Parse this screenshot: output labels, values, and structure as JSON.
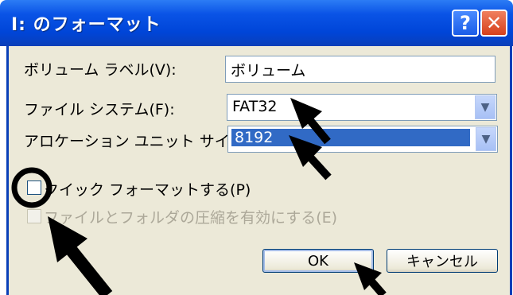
{
  "dialog": {
    "title": "I: のフォーマット",
    "help_glyph": "?",
    "close_glyph": "✕",
    "volume_label": {
      "label": "ボリューム ラベル(V):",
      "value": "ボリューム"
    },
    "file_system": {
      "label": "ファイル システム(F):",
      "value": "FAT32"
    },
    "allocation_unit": {
      "label": "アロケーション ユニット サイズ(A):",
      "value": "8192"
    },
    "quick_format": {
      "label": "クイック フォーマットする(P)",
      "checked": false
    },
    "compression": {
      "label": "ファイルとフォルダの圧縮を有効にする(E)",
      "enabled": false
    },
    "ok_label": "OK",
    "cancel_label": "キャンセル",
    "dropdown_glyph": "▼"
  },
  "colors": {
    "titlebar": "#0045d8",
    "selection": "#316ac5",
    "annotation": "#000000"
  }
}
